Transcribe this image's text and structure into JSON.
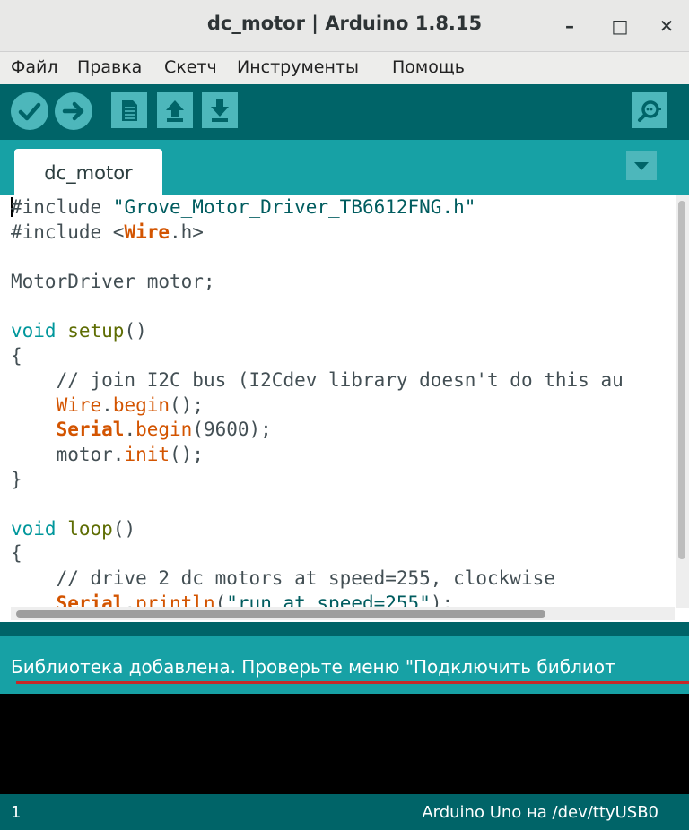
{
  "window": {
    "title": "dc_motor | Arduino 1.8.15",
    "minimize": "–",
    "maximize": "□",
    "close": "✕"
  },
  "menu": [
    "Файл",
    "Правка",
    "Скетч",
    "Инструменты",
    "Помощь"
  ],
  "toolbar": {
    "verify": "check-icon",
    "upload": "arrow-right-icon",
    "new": "new-file-icon",
    "open": "upload-arrow-icon",
    "save": "download-arrow-icon",
    "serial_monitor": "magnifier-icon"
  },
  "tab": {
    "name": "dc_motor"
  },
  "code": [
    [
      [
        "pp",
        "#include "
      ],
      [
        "str",
        "\"Grove_Motor_Driver_TB6612FNG.h\""
      ]
    ],
    [
      [
        "pp",
        "#include <"
      ],
      [
        "cl",
        "Wire"
      ],
      [
        "pp",
        ".h>"
      ]
    ],
    [],
    [
      [
        "t",
        "MotorDriver motor;"
      ]
    ],
    [],
    [
      [
        "ty",
        "void"
      ],
      [
        "t",
        " "
      ],
      [
        "kw",
        "setup"
      ],
      [
        "t",
        "()"
      ]
    ],
    [
      [
        "t",
        "{"
      ]
    ],
    [
      [
        "t",
        "    "
      ],
      [
        "cm",
        "// join I2C bus (I2Cdev library doesn't do this au"
      ]
    ],
    [
      [
        "t",
        "    "
      ],
      [
        "fn",
        "Wire"
      ],
      [
        "t",
        "."
      ],
      [
        "fn",
        "begin"
      ],
      [
        "t",
        "();"
      ]
    ],
    [
      [
        "t",
        "    "
      ],
      [
        "cl",
        "Serial"
      ],
      [
        "t",
        "."
      ],
      [
        "fn",
        "begin"
      ],
      [
        "t",
        "(9600);"
      ]
    ],
    [
      [
        "t",
        "    motor."
      ],
      [
        "fn",
        "init"
      ],
      [
        "t",
        "();"
      ]
    ],
    [
      [
        "t",
        "}"
      ]
    ],
    [],
    [
      [
        "ty",
        "void"
      ],
      [
        "t",
        " "
      ],
      [
        "kw",
        "loop"
      ],
      [
        "t",
        "()"
      ]
    ],
    [
      [
        "t",
        "{"
      ]
    ],
    [
      [
        "t",
        "    "
      ],
      [
        "cm",
        "// drive 2 dc motors at speed=255, clockwise"
      ]
    ],
    [
      [
        "t",
        "    "
      ],
      [
        "cl",
        "Serial"
      ],
      [
        "t",
        "."
      ],
      [
        "fn",
        "println"
      ],
      [
        "t",
        "("
      ],
      [
        "str",
        "\"run at speed=255\""
      ],
      [
        "t",
        ");"
      ]
    ]
  ],
  "colors": {
    "teal_dark": "#006468",
    "teal": "#17a1a5",
    "button": "#4db7bb",
    "underline": "#c62828"
  },
  "status": {
    "message": "Библиотека добавлена. Проверьте меню \"Подключить библиот"
  },
  "footer": {
    "line": "1",
    "board": "Arduino Uno на /dev/ttyUSB0"
  }
}
